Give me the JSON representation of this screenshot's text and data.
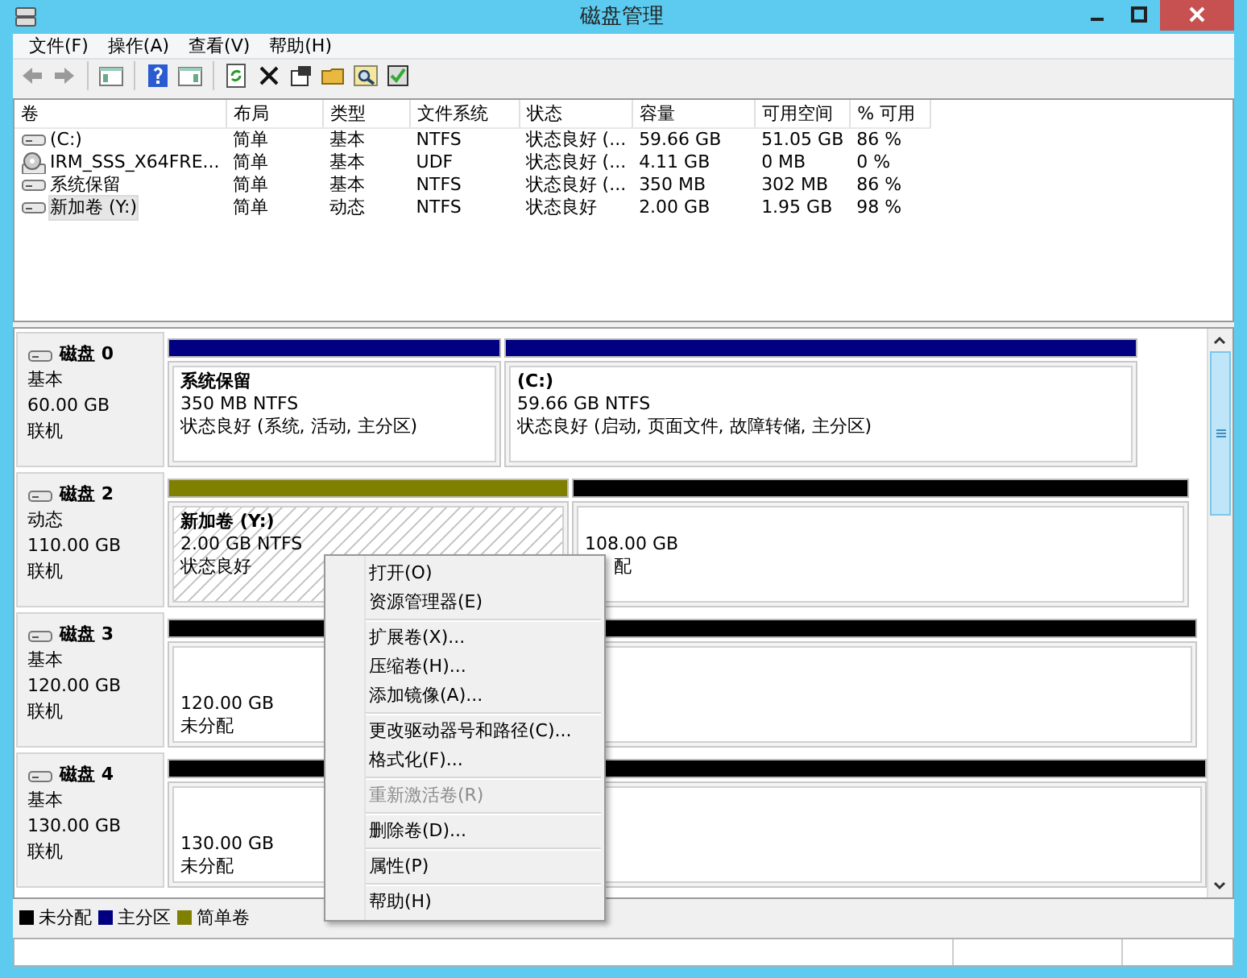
{
  "window": {
    "title": "磁盘管理"
  },
  "menu_bar": [
    "文件(F)",
    "操作(A)",
    "查看(V)",
    "帮助(H)"
  ],
  "volume_list": {
    "columns": [
      "卷",
      "布局",
      "类型",
      "文件系统",
      "状态",
      "容量",
      "可用空间",
      "% 可用"
    ],
    "rows": [
      {
        "kind": "disk",
        "selected": false,
        "cells": [
          "(C:)",
          "简单",
          "基本",
          "NTFS",
          "状态良好 (...",
          "59.66 GB",
          "51.05 GB",
          "86 %"
        ]
      },
      {
        "kind": "disc",
        "selected": false,
        "cells": [
          "IRM_SSS_X64FRE...",
          "简单",
          "基本",
          "UDF",
          "状态良好 (...",
          "4.11 GB",
          "0 MB",
          "0 %"
        ]
      },
      {
        "kind": "disk",
        "selected": false,
        "cells": [
          "系统保留",
          "简单",
          "基本",
          "NTFS",
          "状态良好 (...",
          "350 MB",
          "302 MB",
          "86 %"
        ]
      },
      {
        "kind": "disk",
        "selected": true,
        "cells": [
          "新加卷 (Y:)",
          "简单",
          "动态",
          "NTFS",
          "状态良好",
          "2.00 GB",
          "1.95 GB",
          "98 %"
        ]
      }
    ]
  },
  "disks": [
    {
      "name": "磁盘 0",
      "type": "基本",
      "size": "60.00 GB",
      "status": "联机",
      "partitions": [
        {
          "name": "系统保留",
          "size": "350 MB NTFS",
          "status": "状态良好 (系统, 活动, 主分区)",
          "color": "#000080",
          "selected": false
        },
        {
          "name": "(C:)",
          "size": "59.66 GB NTFS",
          "status": "状态良好 (启动, 页面文件, 故障转储, 主分区)",
          "color": "#000080",
          "selected": false
        }
      ]
    },
    {
      "name": "磁盘 2",
      "type": "动态",
      "size": "110.00 GB",
      "status": "联机",
      "partitions": [
        {
          "name": "新加卷  (Y:)",
          "size": "2.00 GB NTFS",
          "status": "状态良好",
          "color": "#808000",
          "selected": true
        },
        {
          "size": "108.00 GB",
          "status": "配",
          "color": "#000000",
          "selected": false
        }
      ]
    },
    {
      "name": "磁盘 3",
      "type": "基本",
      "size": "120.00 GB",
      "status": "联机",
      "partitions": [
        {
          "size": "120.00 GB",
          "status": "未分配",
          "color": "#000000",
          "selected": false
        }
      ]
    },
    {
      "name": "磁盘 4",
      "type": "基本",
      "size": "130.00 GB",
      "status": "联机",
      "partitions": [
        {
          "size": "130.00 GB",
          "status": "未分配",
          "color": "#000000",
          "selected": false
        }
      ]
    }
  ],
  "legend": [
    {
      "label": "未分配",
      "color": "#000000"
    },
    {
      "label": "主分区",
      "color": "#000080"
    },
    {
      "label": "简单卷",
      "color": "#808000"
    }
  ],
  "context_menu": {
    "groups": [
      [
        {
          "label": "打开(O)",
          "disabled": false
        },
        {
          "label": "资源管理器(E)",
          "disabled": false
        }
      ],
      [
        {
          "label": "扩展卷(X)...",
          "disabled": false
        },
        {
          "label": "压缩卷(H)...",
          "disabled": false
        },
        {
          "label": "添加镜像(A)...",
          "disabled": false
        }
      ],
      [
        {
          "label": "更改驱动器号和路径(C)...",
          "disabled": false
        },
        {
          "label": "格式化(F)...",
          "disabled": false
        }
      ],
      [
        {
          "label": "重新激活卷(R)",
          "disabled": true
        }
      ],
      [
        {
          "label": "删除卷(D)...",
          "disabled": false
        }
      ],
      [
        {
          "label": "属性(P)",
          "disabled": false
        }
      ],
      [
        {
          "label": "帮助(H)",
          "disabled": false
        }
      ]
    ]
  }
}
